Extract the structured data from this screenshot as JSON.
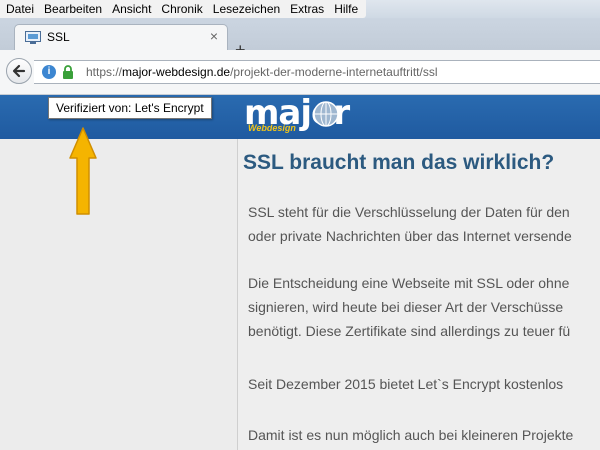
{
  "menu": {
    "items": [
      "Datei",
      "Bearbeiten",
      "Ansicht",
      "Chronik",
      "Lesezeichen",
      "Extras",
      "Hilfe"
    ]
  },
  "tab": {
    "title": "SSL",
    "close": "×",
    "new": "+"
  },
  "urlbar": {
    "prefix": "https://",
    "host": "major-webdesign.de",
    "path": "/projekt-der-moderne-internetauftritt/ssl",
    "info": "i"
  },
  "tooltip": "Verifiziert von: Let's Encrypt",
  "logo": {
    "word": "major",
    "sub": "Webdesign"
  },
  "content": {
    "heading": "SSL braucht man das wirklich?",
    "lines": [
      "SSL steht für die Verschlüsselung der Daten für den",
      "oder private Nachrichten über das Internet versende",
      "Die Entscheidung eine Webseite mit SSL oder ohne",
      "signieren, wird heute bei dieser Art der Verschüsse",
      "benötigt. Diese Zertifikate sind allerdings zu teuer fü",
      "Seit Dezember 2015 bietet Let`s Encrypt kostenlos",
      "Damit ist es nun möglich auch bei kleineren Projekte"
    ]
  },
  "colors": {
    "banner": "#1f5aa0",
    "arrow": "#f5b400",
    "heading": "#2c5a80",
    "lock": "#3aa03a"
  }
}
